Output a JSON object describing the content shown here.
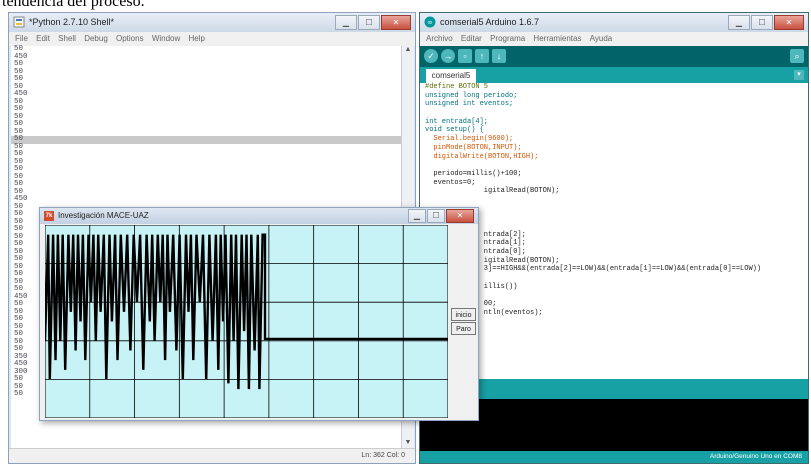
{
  "caption": "tendencia del proceso.",
  "python": {
    "title": "*Python 2.7.10 Shell*",
    "menu": [
      "File",
      "Edit",
      "Shell",
      "Debug",
      "Options",
      "Window",
      "Help"
    ],
    "status": "Ln: 362  Col: 0",
    "lines": [
      "50",
      "450",
      "50",
      "50",
      "50",
      "50",
      "450",
      "50",
      "50",
      "50",
      "50",
      "50",
      "50",
      "50",
      "50",
      "50",
      "50",
      "50",
      "50",
      "50",
      "450",
      "50",
      "50",
      "50",
      "50",
      "50",
      "50",
      "50",
      "50",
      "50",
      "50",
      "50",
      "50",
      "450",
      "50",
      "50",
      "50",
      "50",
      "50",
      "50",
      "50",
      "350",
      "450",
      "300",
      "50",
      "50",
      "50"
    ],
    "highlight_index": 12
  },
  "arduino": {
    "title": "comserial5 Arduino 1.6.7",
    "menu": [
      "Archivo",
      "Editar",
      "Programa",
      "Herramientas",
      "Ayuda"
    ],
    "tab": "comserial5",
    "status": "Arduino/Genuino Uno en COM8",
    "code": [
      "#define BOTON 5",
      "unsigned long periodo;",
      "unsigned int eventos;",
      "",
      "int entrada[4];",
      "void setup() {",
      "  Serial.begin(9600);",
      "  pinMode(BOTON,INPUT);",
      "  digitalWrite(BOTON,HIGH);",
      "",
      "  periodo=millis()+100;",
      "  eventos=0;",
      "              igitalRead(BOTON);",
      "",
      "",
      "",
      "",
      "              ntrada[2];",
      "              ntrada[1];",
      "              ntrada[0];",
      "              igitalRead(BOTON);",
      "              3]==HIGH&&(entrada[2]==LOW)&&(entrada[1]==LOW)&&(entrada[0]==LOW))",
      "",
      "              illis())",
      "",
      "              00;",
      "              ntln(eventos);"
    ]
  },
  "plot_window": {
    "title": "Investigación MACE-UAZ",
    "icon": "tk-icon",
    "bg_color": "#c8f3f6",
    "grid_color": "#000000",
    "buttons": {
      "inicio": "inicio",
      "paro": "Paro"
    }
  },
  "chart_data": {
    "type": "line",
    "title": "",
    "xlabel": "",
    "ylabel": "",
    "grid": true,
    "grid_cols": 9,
    "grid_rows": 5,
    "xlim": [
      0,
      1
    ],
    "ylim": [
      0,
      1
    ],
    "series": [
      {
        "points": [
          [
            0.0,
            0.4
          ],
          [
            0.008,
            0.95
          ],
          [
            0.012,
            0.2
          ],
          [
            0.02,
            0.95
          ],
          [
            0.026,
            0.3
          ],
          [
            0.032,
            0.95
          ],
          [
            0.038,
            0.4
          ],
          [
            0.044,
            0.95
          ],
          [
            0.05,
            0.25
          ],
          [
            0.058,
            0.95
          ],
          [
            0.064,
            0.55
          ],
          [
            0.07,
            0.95
          ],
          [
            0.076,
            0.35
          ],
          [
            0.082,
            0.95
          ],
          [
            0.088,
            0.5
          ],
          [
            0.094,
            0.95
          ],
          [
            0.1,
            0.3
          ],
          [
            0.108,
            0.95
          ],
          [
            0.114,
            0.6
          ],
          [
            0.12,
            0.95
          ],
          [
            0.126,
            0.4
          ],
          [
            0.132,
            0.95
          ],
          [
            0.138,
            0.55
          ],
          [
            0.146,
            0.95
          ],
          [
            0.152,
            0.2
          ],
          [
            0.16,
            0.95
          ],
          [
            0.166,
            0.5
          ],
          [
            0.174,
            0.95
          ],
          [
            0.18,
            0.3
          ],
          [
            0.188,
            0.95
          ],
          [
            0.196,
            0.55
          ],
          [
            0.204,
            0.95
          ],
          [
            0.212,
            0.35
          ],
          [
            0.22,
            0.95
          ],
          [
            0.228,
            0.6
          ],
          [
            0.236,
            0.95
          ],
          [
            0.244,
            0.25
          ],
          [
            0.252,
            0.95
          ],
          [
            0.26,
            0.5
          ],
          [
            0.266,
            0.95
          ],
          [
            0.272,
            0.4
          ],
          [
            0.28,
            0.95
          ],
          [
            0.286,
            0.6
          ],
          [
            0.292,
            0.95
          ],
          [
            0.298,
            0.3
          ],
          [
            0.304,
            0.95
          ],
          [
            0.31,
            0.55
          ],
          [
            0.318,
            0.95
          ],
          [
            0.326,
            0.35
          ],
          [
            0.334,
            0.95
          ],
          [
            0.342,
            0.2
          ],
          [
            0.35,
            0.95
          ],
          [
            0.356,
            0.55
          ],
          [
            0.362,
            0.95
          ],
          [
            0.368,
            0.3
          ],
          [
            0.376,
            0.95
          ],
          [
            0.384,
            0.6
          ],
          [
            0.392,
            0.95
          ],
          [
            0.4,
            0.2
          ],
          [
            0.408,
            0.95
          ],
          [
            0.416,
            0.4
          ],
          [
            0.424,
            0.95
          ],
          [
            0.43,
            0.25
          ],
          [
            0.436,
            0.95
          ],
          [
            0.442,
            0.5
          ],
          [
            0.448,
            0.95
          ],
          [
            0.455,
            0.18
          ],
          [
            0.462,
            0.95
          ],
          [
            0.468,
            0.4
          ],
          [
            0.474,
            0.95
          ],
          [
            0.48,
            0.15
          ],
          [
            0.488,
            0.95
          ],
          [
            0.494,
            0.45
          ],
          [
            0.5,
            0.95
          ],
          [
            0.506,
            0.15
          ],
          [
            0.512,
            0.95
          ],
          [
            0.52,
            0.35
          ],
          [
            0.528,
            0.95
          ],
          [
            0.532,
            0.15
          ],
          [
            0.54,
            0.95
          ],
          [
            0.546,
            0.95
          ],
          [
            0.546,
            0.41
          ],
          [
            1.0,
            0.41
          ]
        ]
      }
    ]
  }
}
